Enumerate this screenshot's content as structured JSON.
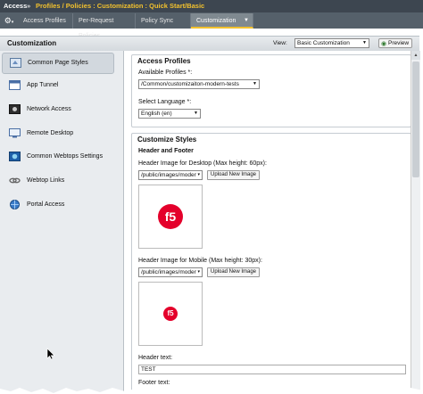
{
  "breadcrumb": {
    "root": "Access",
    "separator": "»",
    "path": "Profiles / Policies : Customization : Quick Start/Basic"
  },
  "tabs": [
    {
      "label": "Access Profiles",
      "active": false
    },
    {
      "label": "Per-Request Policies",
      "active": false
    },
    {
      "label": "Policy Sync",
      "active": false
    },
    {
      "label": "Customization",
      "active": true
    }
  ],
  "header": {
    "title": "Customization",
    "view_label": "View:",
    "view_value": "Basic Customization",
    "preview_label": "Preview"
  },
  "sidebar": {
    "items": [
      {
        "label": "Common Page Styles",
        "icon": "page-styles-icon",
        "active": true
      },
      {
        "label": "App Tunnel",
        "icon": "app-tunnel-icon",
        "active": false
      },
      {
        "label": "Network Access",
        "icon": "network-access-icon",
        "active": false
      },
      {
        "label": "Remote Desktop",
        "icon": "remote-desktop-icon",
        "active": false
      },
      {
        "label": "Common Webtops Settings",
        "icon": "webtop-settings-icon",
        "active": false
      },
      {
        "label": "Webtop Links",
        "icon": "webtop-links-icon",
        "active": false
      },
      {
        "label": "Portal Access",
        "icon": "portal-access-icon",
        "active": false
      }
    ]
  },
  "access_profiles": {
    "title": "Access Profiles",
    "available_label": "Available Profiles *:",
    "available_value": "/Common/customizaiton-modern-tests",
    "language_label": "Select Language *:",
    "language_value": "English (en)"
  },
  "customize_styles": {
    "title": "Customize Styles",
    "section": "Header and Footer",
    "desktop_label": "Header Image for Desktop (Max height: 60px):",
    "desktop_path": "/public/images/moder",
    "mobile_label": "Header Image for Mobile (Max height: 30px):",
    "mobile_path": "/public/images/moder",
    "upload_label": "Upload New Image",
    "logo_text": "f5",
    "header_text_label": "Header text:",
    "header_text_value": "TEST",
    "footer_text_label": "Footer text:"
  },
  "colors": {
    "topbar": "#3d4650",
    "accent": "#f2c12e",
    "logo": "#e4002b"
  }
}
